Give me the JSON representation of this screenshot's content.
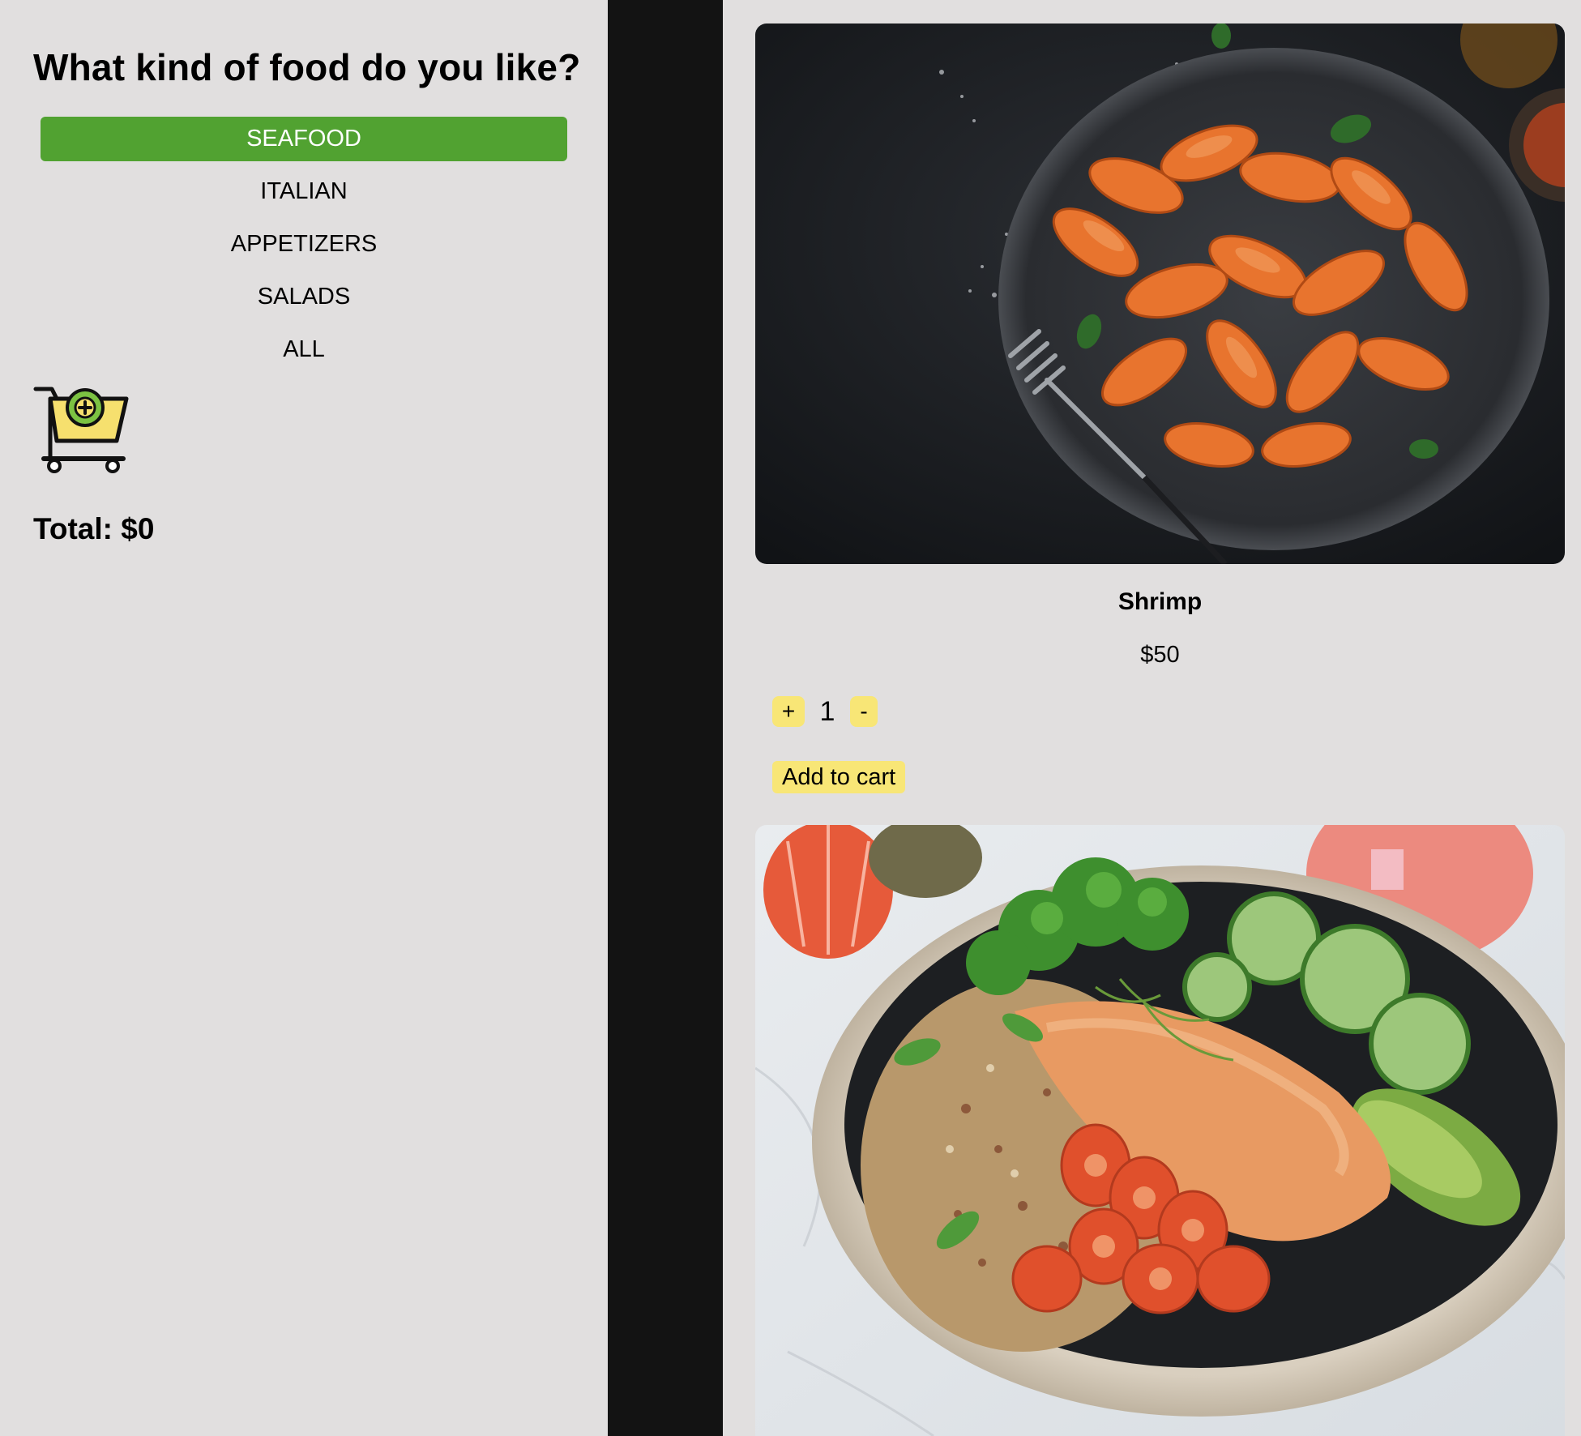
{
  "sidebar": {
    "title": "What kind of food do you like?",
    "categories": [
      {
        "label": "SEAFOOD",
        "active": true
      },
      {
        "label": "ITALIAN",
        "active": false
      },
      {
        "label": "APPETIZERS",
        "active": false
      },
      {
        "label": "SALADS",
        "active": false
      },
      {
        "label": "ALL",
        "active": false
      }
    ],
    "cart_icon": "cart-add-icon",
    "total_label": "Total:",
    "total_value": "$0"
  },
  "products": [
    {
      "name": "Shrimp",
      "price": "$50",
      "quantity": "1",
      "plus_label": "+",
      "minus_label": "-",
      "add_to_cart_label": "Add to cart",
      "image": "grilled-shrimp-plate-photo"
    },
    {
      "image": "salmon-quinoa-bowl-photo"
    }
  ],
  "colors": {
    "accent_green": "#51a231",
    "button_yellow": "#f8e676",
    "panel_background": "#e1dfdf",
    "divider": "#131313"
  }
}
